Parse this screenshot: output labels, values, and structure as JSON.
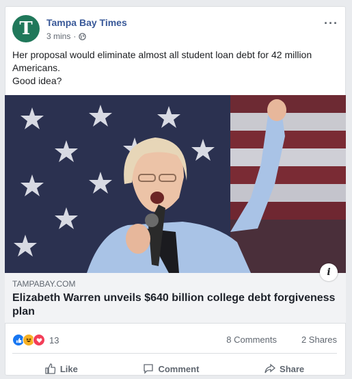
{
  "post": {
    "page_name": "Tampa Bay Times",
    "avatar_letter": "T",
    "timestamp": "3 mins",
    "separator": "·",
    "more_label": "···",
    "text_line1": "Her proposal would eliminate almost all student loan debt for 42 million Americans.",
    "text_line2": "Good idea?"
  },
  "link": {
    "domain": "TAMPABAY.COM",
    "headline": "Elizabeth Warren unveils $640 billion college debt forgiveness plan",
    "info_label": "i"
  },
  "stats": {
    "reaction_count": "13",
    "comments": "8 Comments",
    "shares": "2 Shares"
  },
  "actions": {
    "like": "Like",
    "comment": "Comment",
    "share": "Share"
  },
  "colors": {
    "page_name": "#385898",
    "avatar": "#20785a",
    "like": "#1877f2",
    "haha": "#f7b125",
    "love": "#f33e58"
  }
}
